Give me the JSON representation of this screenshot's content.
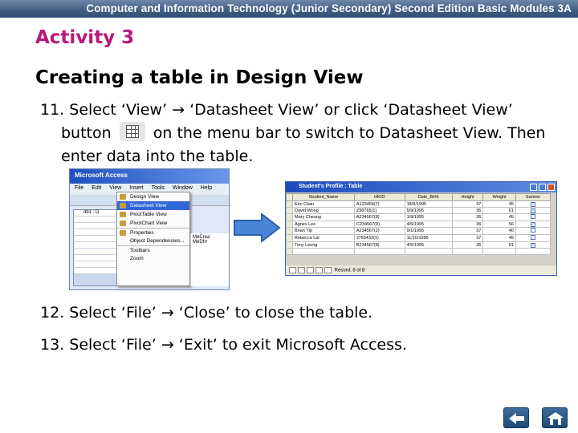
{
  "header": {
    "title": "Computer and Information Technology (Junior Secondary) Second Edition Basic Modules 3A"
  },
  "activity_title": "Activity 3",
  "heading": "Creating a table in Design View",
  "steps": {
    "s11": {
      "line1": "11. Select ‘View’ → ‘Datasheet View’ or click ‘Datasheet View’",
      "line2a": "button",
      "line2b": "on the menu bar to switch to Datasheet View. Then",
      "line3": "enter data into the table."
    },
    "s12": "12. Select ‘File’ → ‘Close’ to close the table.",
    "s13": "13. Select ‘File’ → ‘Exit’ to exit Microsoft Access."
  },
  "screenshot_left": {
    "window_title": "Microsoft Access",
    "menu_bar": [
      "File",
      "Edit",
      "View",
      "Insert",
      "Tools",
      "Window",
      "Help"
    ],
    "view_menu": [
      "Design View",
      "Datasheet View",
      "PivotTable View",
      "PivotChart View",
      "Properties",
      "Object Dependencies...",
      "Toolbars",
      "Zoom"
    ],
    "db_label": "db1 : D",
    "side_text": [
      "MeCrea",
      "MeDfrr"
    ]
  },
  "screenshot_right": {
    "window_title": "Student's Profile : Table",
    "columns": [
      "Student_Name",
      "HKID",
      "Date_Birth",
      "Height",
      "Weight",
      "Swimer"
    ],
    "rows": [
      [
        "Eric Chan",
        "A123456(7)",
        "18/9/1995",
        "37",
        "45",
        true
      ],
      [
        "David Wong",
        "Z98765(1)",
        "5/9/1995",
        "36",
        "61",
        true
      ],
      [
        "Mary Cheung",
        "A234567(8)",
        "1/9/1995",
        "36",
        "45",
        false
      ],
      [
        "Agnes Lee",
        "C234567(9)",
        "4/5/1995",
        "36",
        "56",
        true
      ],
      [
        "Brian Yip",
        "A234567(2)",
        "9/1/1995",
        "37",
        "40",
        false
      ],
      [
        "Rebecca Lai",
        "J765432(1)",
        "11/10/1995",
        "37",
        "45",
        false
      ],
      [
        "Tony Leung",
        "B234567(8)",
        "4/5/1995",
        "36",
        "61",
        true
      ]
    ],
    "record_nav": "Record: 8 of 8"
  },
  "icons": {
    "datasheet_view_button": "datasheet-view-icon",
    "arrow": "right-arrow-icon",
    "back": "back-arrow-icon",
    "home": "home-icon"
  },
  "colors": {
    "header_bar": "#3f5c82",
    "activity": "#b8177a",
    "nav_button": "#2c5a87",
    "arrow_fill": "#4a86d8"
  }
}
